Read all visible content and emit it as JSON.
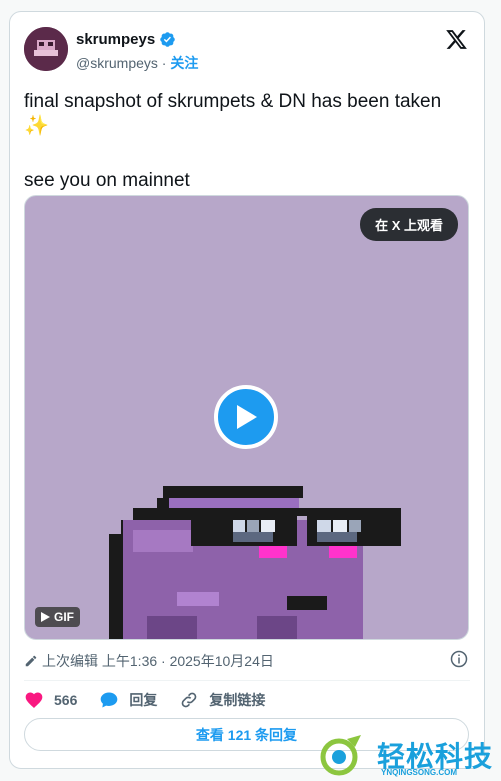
{
  "user": {
    "name": "skrumpeys",
    "handle": "@skrumpeys",
    "separator": "·",
    "follow_label": "关注"
  },
  "tweet": {
    "line1": "final snapshot of skrumpets & DN has been taken",
    "line1_emoji": "✨",
    "line2": "see you on mainnet"
  },
  "media": {
    "watch_label": "在 X 上观看",
    "gif_label": "GIF"
  },
  "meta": {
    "edited_text": "上次编辑 上午1:36 · 2025年10月24日"
  },
  "actions": {
    "likes": "566",
    "reply_label": "回复",
    "copy_link_label": "复制链接"
  },
  "view_replies_label": "查看 121 条回复",
  "watermark": {
    "text": "轻松科技",
    "sub": "YNQINGSONG.COM"
  },
  "colors": {
    "accent": "#1d9bf0",
    "like": "#f91880",
    "media_bg": "#b7a7c9"
  }
}
